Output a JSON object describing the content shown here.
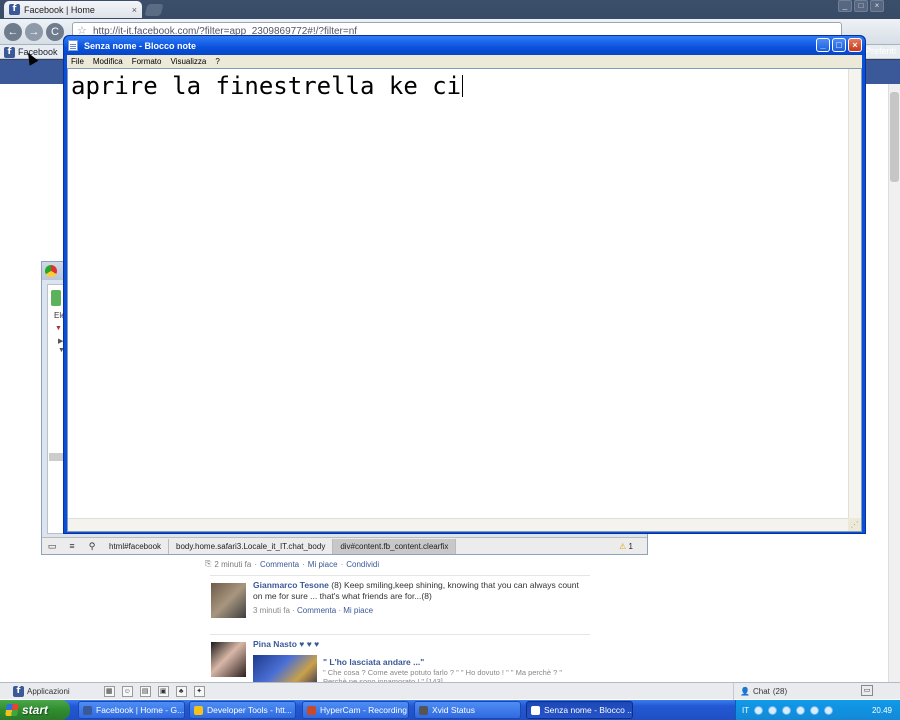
{
  "browser": {
    "tab_title": "Facebook | Home",
    "tab_close": "×",
    "url": "http://it-it.facebook.com/?filter=app_2309869772#!/?filter=nf",
    "bookmark_label": "Facebook",
    "bookmarks_right": "Preferiti",
    "back": "←",
    "forward": "→",
    "reload": "C",
    "star": "☆"
  },
  "devtools": {
    "elements_label": "Ele",
    "breadcrumbs": [
      "html#facebook",
      "body.home.safari3.Locale_it_IT.chat_body",
      "div#content.fb_content.clearfix"
    ],
    "warnings": "1"
  },
  "notepad": {
    "title": "Senza nome - Blocco note",
    "menu": [
      "File",
      "Modifica",
      "Formato",
      "Visualizza",
      "?"
    ],
    "text": "aprire la finestrella ke ci",
    "controls": {
      "min": "_",
      "max": "□",
      "close": "×"
    }
  },
  "feed": {
    "first_meta": {
      "time": "2 minuti fa",
      "comment": "Commenta",
      "like": "Mi piace",
      "share": "Condividi"
    },
    "stories": [
      {
        "name": "Gianmarco Tesone",
        "text": "(8) Keep smiling,keep shining, knowing that you can always count on me for sure ... that's what friends are for...(8)",
        "time": "3 minuti fa",
        "comment": "Commenta",
        "like": "Mi piace"
      },
      {
        "name": "Pina Nasto ♥ ♥ ♥",
        "attach_title": "\" L'ho lasciata andare ...\"",
        "attach_desc": "\" Che cosa ? Come avete potuto farlo ? \" \" Ho dovuto ! \" \" Ma perchè ? \" Perchè ne sono innamorato ! \" [143]"
      }
    ]
  },
  "fb_bar": {
    "apps": "Applicazioni",
    "chat": "Chat",
    "chat_count": "(28)"
  },
  "taskbar": {
    "start": "start",
    "items": [
      {
        "label": "Facebook | Home - G...",
        "color": "#3b5998"
      },
      {
        "label": "Developer Tools - htt...",
        "color": "#f5c21b"
      },
      {
        "label": "HyperCam - Recording",
        "color": "#c84a2a"
      },
      {
        "label": "Xvid Status",
        "color": "#555555"
      },
      {
        "label": "Senza nome - Blocco ...",
        "color": "#ffffff"
      }
    ],
    "lang": "IT",
    "time": "20.49"
  }
}
